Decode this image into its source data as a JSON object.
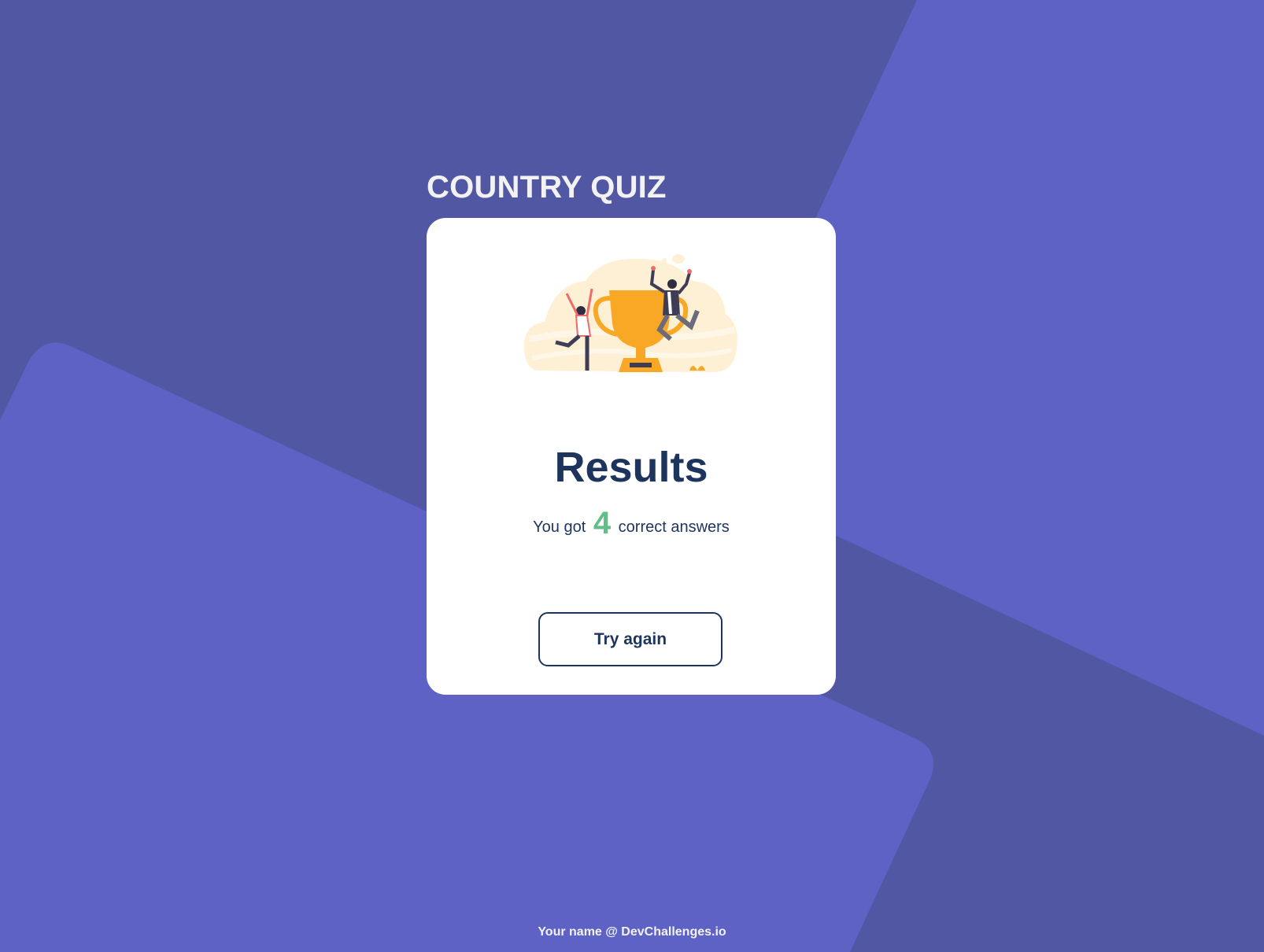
{
  "app": {
    "title": "COUNTRY QUIZ"
  },
  "result": {
    "heading": "Results",
    "prefix": "You got",
    "score": "4",
    "suffix": "correct answers"
  },
  "actions": {
    "try_again_label": "Try again"
  },
  "footer": {
    "credit": "Your name @ DevChallenges.io"
  },
  "colors": {
    "background": "#5257a3",
    "background_shape": "#5d62c4",
    "card": "#ffffff",
    "heading_text": "#1d355d",
    "score_accent": "#60bf88",
    "trophy": "#f9a826"
  },
  "icons": {
    "illustration": "trophy-celebration-illustration"
  }
}
